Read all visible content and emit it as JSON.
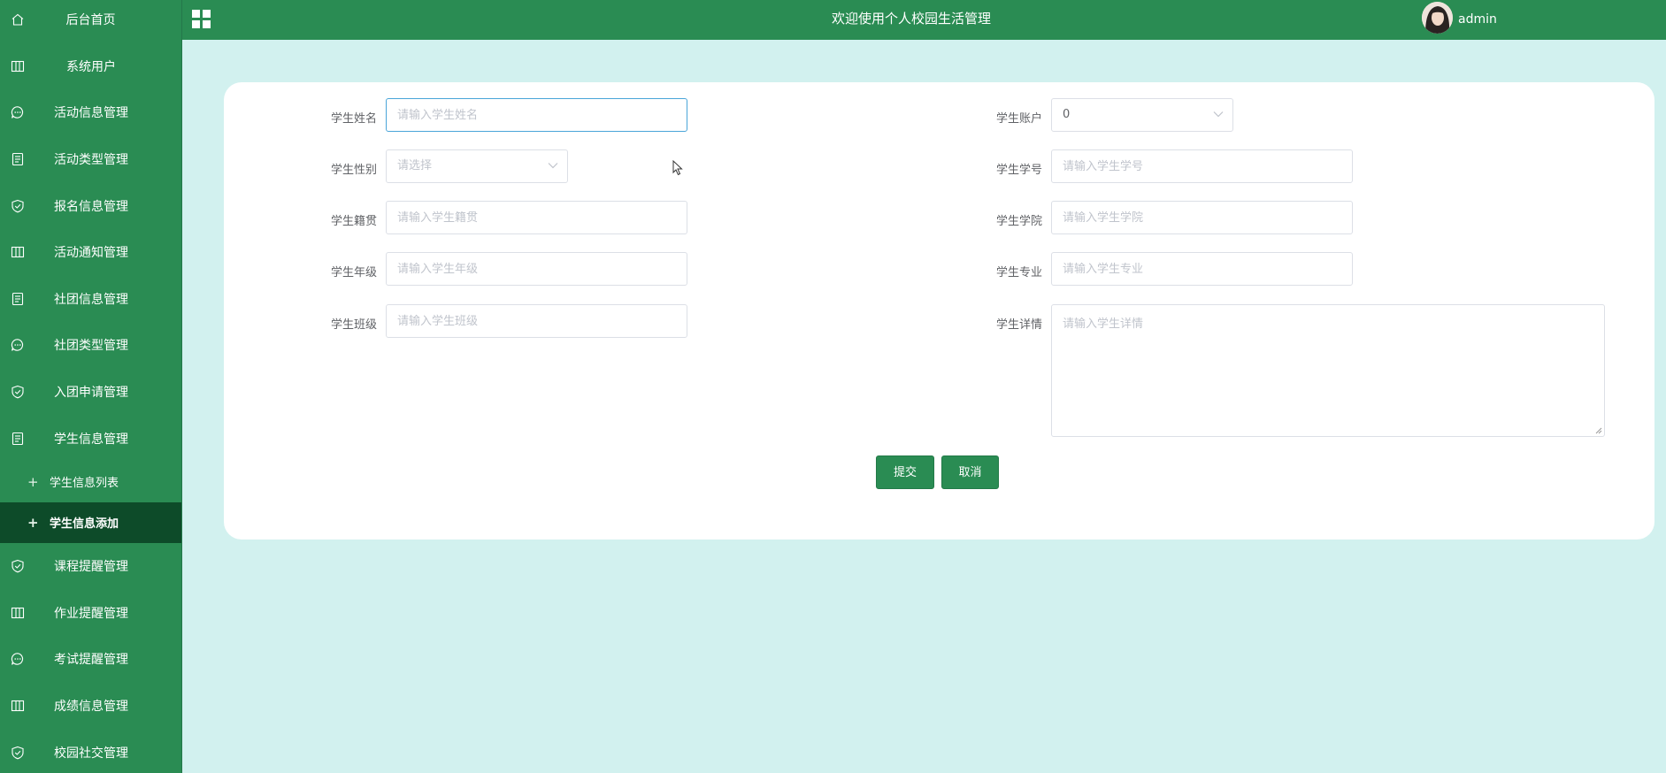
{
  "sidebar": {
    "items": [
      {
        "label": "后台首页",
        "icon": "home-icon"
      },
      {
        "label": "系统用户",
        "icon": "columns-icon"
      },
      {
        "label": "活动信息管理",
        "icon": "chat-icon"
      },
      {
        "label": "活动类型管理",
        "icon": "document-icon"
      },
      {
        "label": "报名信息管理",
        "icon": "shield-check-icon"
      },
      {
        "label": "活动通知管理",
        "icon": "columns-icon"
      },
      {
        "label": "社团信息管理",
        "icon": "document-icon"
      },
      {
        "label": "社团类型管理",
        "icon": "chat-icon"
      },
      {
        "label": "入团申请管理",
        "icon": "shield-check-icon"
      },
      {
        "label": "学生信息管理",
        "icon": "document-icon"
      }
    ],
    "sub_items": [
      {
        "label": "学生信息列表"
      },
      {
        "label": "学生信息添加"
      }
    ],
    "items_after": [
      {
        "label": "课程提醒管理",
        "icon": "shield-check-icon"
      },
      {
        "label": "作业提醒管理",
        "icon": "columns-icon"
      },
      {
        "label": "考试提醒管理",
        "icon": "chat-icon"
      },
      {
        "label": "成绩信息管理",
        "icon": "columns-icon"
      },
      {
        "label": "校园社交管理",
        "icon": "shield-check-icon"
      }
    ]
  },
  "header": {
    "title": "欢迎使用个人校园生活管理",
    "username": "admin"
  },
  "form": {
    "name": {
      "label": "学生姓名",
      "placeholder": "请输入学生姓名"
    },
    "account": {
      "label": "学生账户",
      "value": "0"
    },
    "gender": {
      "label": "学生性别",
      "placeholder": "请选择"
    },
    "student_no": {
      "label": "学生学号",
      "placeholder": "请输入学生学号"
    },
    "hometown": {
      "label": "学生籍贯",
      "placeholder": "请输入学生籍贯"
    },
    "college": {
      "label": "学生学院",
      "placeholder": "请输入学生学院"
    },
    "grade": {
      "label": "学生年级",
      "placeholder": "请输入学生年级"
    },
    "major": {
      "label": "学生专业",
      "placeholder": "请输入学生专业"
    },
    "class": {
      "label": "学生班级",
      "placeholder": "请输入学生班级"
    },
    "detail": {
      "label": "学生详情",
      "placeholder": "请输入学生详情"
    },
    "submit_label": "提交",
    "cancel_label": "取消"
  },
  "colors": {
    "primary": "#2a8c53",
    "active_menu": "#0d4b29",
    "page_bg": "#d2f1ef",
    "focus_border": "#4aa5d9"
  }
}
